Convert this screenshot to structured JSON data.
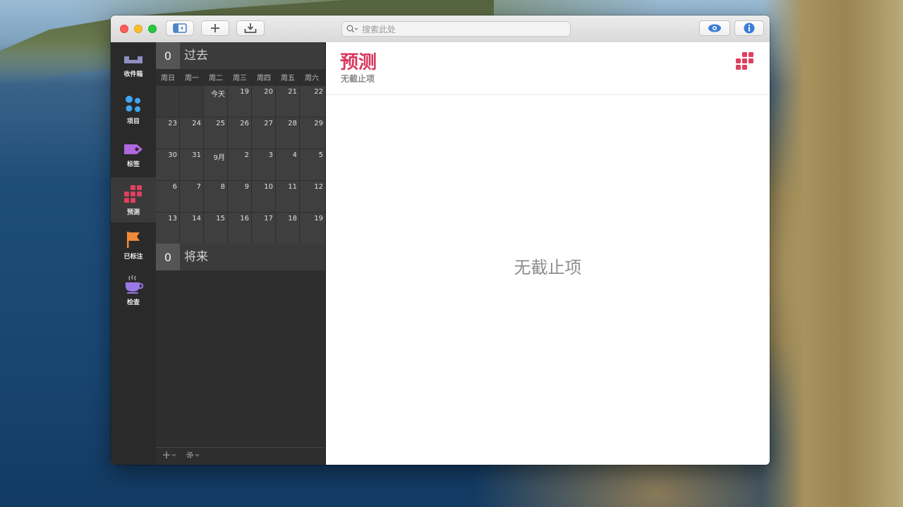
{
  "window": {
    "search_placeholder": "搜索此处"
  },
  "sidebar": {
    "items": [
      {
        "label": "收件箱",
        "icon": "inbox-icon",
        "color": "#8f8fc2"
      },
      {
        "label": "项目",
        "icon": "projects-icon",
        "color": "#3ea7f2"
      },
      {
        "label": "标签",
        "icon": "tag-icon",
        "color": "#b068e0"
      },
      {
        "label": "预测",
        "icon": "forecast-icon",
        "color": "#e0405f"
      },
      {
        "label": "已标注",
        "icon": "flag-icon",
        "color": "#f08a3a"
      },
      {
        "label": "检查",
        "icon": "review-icon",
        "color": "#9a78e8"
      }
    ]
  },
  "calendar": {
    "past": {
      "count": "0",
      "label": "过去"
    },
    "future": {
      "count": "0",
      "label": "将来"
    },
    "weekdays": [
      "周日",
      "周一",
      "周二",
      "周三",
      "周四",
      "周五",
      "周六"
    ],
    "weeks": [
      [
        "",
        "",
        "今天",
        "19",
        "20",
        "21",
        "22"
      ],
      [
        "23",
        "24",
        "25",
        "26",
        "27",
        "28",
        "29"
      ],
      [
        "30",
        "31",
        "9月",
        "2",
        "3",
        "4",
        "5"
      ],
      [
        "6",
        "7",
        "8",
        "9",
        "10",
        "11",
        "12"
      ],
      [
        "13",
        "14",
        "15",
        "16",
        "17",
        "18",
        "19"
      ]
    ]
  },
  "main": {
    "title": "预测",
    "subtitle": "无截止项",
    "empty_message": "无截止项",
    "accent": "#d8385e"
  }
}
